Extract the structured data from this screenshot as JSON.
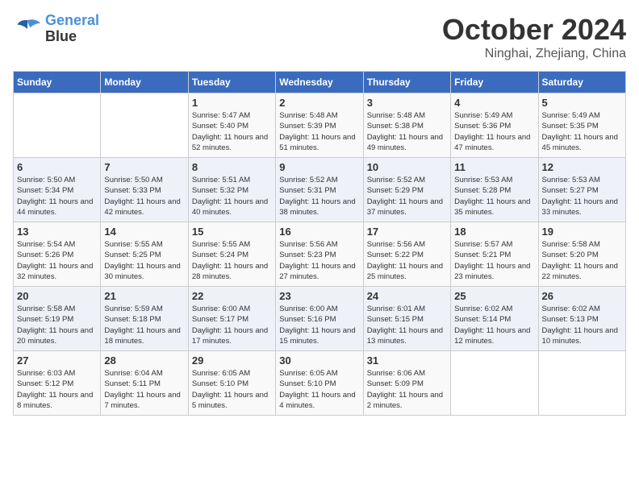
{
  "logo": {
    "line1": "General",
    "line2": "Blue"
  },
  "title": "October 2024",
  "location": "Ninghai, Zhejiang, China",
  "weekdays": [
    "Sunday",
    "Monday",
    "Tuesday",
    "Wednesday",
    "Thursday",
    "Friday",
    "Saturday"
  ],
  "weeks": [
    [
      {
        "day": "",
        "info": ""
      },
      {
        "day": "",
        "info": ""
      },
      {
        "day": "1",
        "info": "Sunrise: 5:47 AM\nSunset: 5:40 PM\nDaylight: 11 hours and 52 minutes."
      },
      {
        "day": "2",
        "info": "Sunrise: 5:48 AM\nSunset: 5:39 PM\nDaylight: 11 hours and 51 minutes."
      },
      {
        "day": "3",
        "info": "Sunrise: 5:48 AM\nSunset: 5:38 PM\nDaylight: 11 hours and 49 minutes."
      },
      {
        "day": "4",
        "info": "Sunrise: 5:49 AM\nSunset: 5:36 PM\nDaylight: 11 hours and 47 minutes."
      },
      {
        "day": "5",
        "info": "Sunrise: 5:49 AM\nSunset: 5:35 PM\nDaylight: 11 hours and 45 minutes."
      }
    ],
    [
      {
        "day": "6",
        "info": "Sunrise: 5:50 AM\nSunset: 5:34 PM\nDaylight: 11 hours and 44 minutes."
      },
      {
        "day": "7",
        "info": "Sunrise: 5:50 AM\nSunset: 5:33 PM\nDaylight: 11 hours and 42 minutes."
      },
      {
        "day": "8",
        "info": "Sunrise: 5:51 AM\nSunset: 5:32 PM\nDaylight: 11 hours and 40 minutes."
      },
      {
        "day": "9",
        "info": "Sunrise: 5:52 AM\nSunset: 5:31 PM\nDaylight: 11 hours and 38 minutes."
      },
      {
        "day": "10",
        "info": "Sunrise: 5:52 AM\nSunset: 5:29 PM\nDaylight: 11 hours and 37 minutes."
      },
      {
        "day": "11",
        "info": "Sunrise: 5:53 AM\nSunset: 5:28 PM\nDaylight: 11 hours and 35 minutes."
      },
      {
        "day": "12",
        "info": "Sunrise: 5:53 AM\nSunset: 5:27 PM\nDaylight: 11 hours and 33 minutes."
      }
    ],
    [
      {
        "day": "13",
        "info": "Sunrise: 5:54 AM\nSunset: 5:26 PM\nDaylight: 11 hours and 32 minutes."
      },
      {
        "day": "14",
        "info": "Sunrise: 5:55 AM\nSunset: 5:25 PM\nDaylight: 11 hours and 30 minutes."
      },
      {
        "day": "15",
        "info": "Sunrise: 5:55 AM\nSunset: 5:24 PM\nDaylight: 11 hours and 28 minutes."
      },
      {
        "day": "16",
        "info": "Sunrise: 5:56 AM\nSunset: 5:23 PM\nDaylight: 11 hours and 27 minutes."
      },
      {
        "day": "17",
        "info": "Sunrise: 5:56 AM\nSunset: 5:22 PM\nDaylight: 11 hours and 25 minutes."
      },
      {
        "day": "18",
        "info": "Sunrise: 5:57 AM\nSunset: 5:21 PM\nDaylight: 11 hours and 23 minutes."
      },
      {
        "day": "19",
        "info": "Sunrise: 5:58 AM\nSunset: 5:20 PM\nDaylight: 11 hours and 22 minutes."
      }
    ],
    [
      {
        "day": "20",
        "info": "Sunrise: 5:58 AM\nSunset: 5:19 PM\nDaylight: 11 hours and 20 minutes."
      },
      {
        "day": "21",
        "info": "Sunrise: 5:59 AM\nSunset: 5:18 PM\nDaylight: 11 hours and 18 minutes."
      },
      {
        "day": "22",
        "info": "Sunrise: 6:00 AM\nSunset: 5:17 PM\nDaylight: 11 hours and 17 minutes."
      },
      {
        "day": "23",
        "info": "Sunrise: 6:00 AM\nSunset: 5:16 PM\nDaylight: 11 hours and 15 minutes."
      },
      {
        "day": "24",
        "info": "Sunrise: 6:01 AM\nSunset: 5:15 PM\nDaylight: 11 hours and 13 minutes."
      },
      {
        "day": "25",
        "info": "Sunrise: 6:02 AM\nSunset: 5:14 PM\nDaylight: 11 hours and 12 minutes."
      },
      {
        "day": "26",
        "info": "Sunrise: 6:02 AM\nSunset: 5:13 PM\nDaylight: 11 hours and 10 minutes."
      }
    ],
    [
      {
        "day": "27",
        "info": "Sunrise: 6:03 AM\nSunset: 5:12 PM\nDaylight: 11 hours and 8 minutes."
      },
      {
        "day": "28",
        "info": "Sunrise: 6:04 AM\nSunset: 5:11 PM\nDaylight: 11 hours and 7 minutes."
      },
      {
        "day": "29",
        "info": "Sunrise: 6:05 AM\nSunset: 5:10 PM\nDaylight: 11 hours and 5 minutes."
      },
      {
        "day": "30",
        "info": "Sunrise: 6:05 AM\nSunset: 5:10 PM\nDaylight: 11 hours and 4 minutes."
      },
      {
        "day": "31",
        "info": "Sunrise: 6:06 AM\nSunset: 5:09 PM\nDaylight: 11 hours and 2 minutes."
      },
      {
        "day": "",
        "info": ""
      },
      {
        "day": "",
        "info": ""
      }
    ]
  ]
}
